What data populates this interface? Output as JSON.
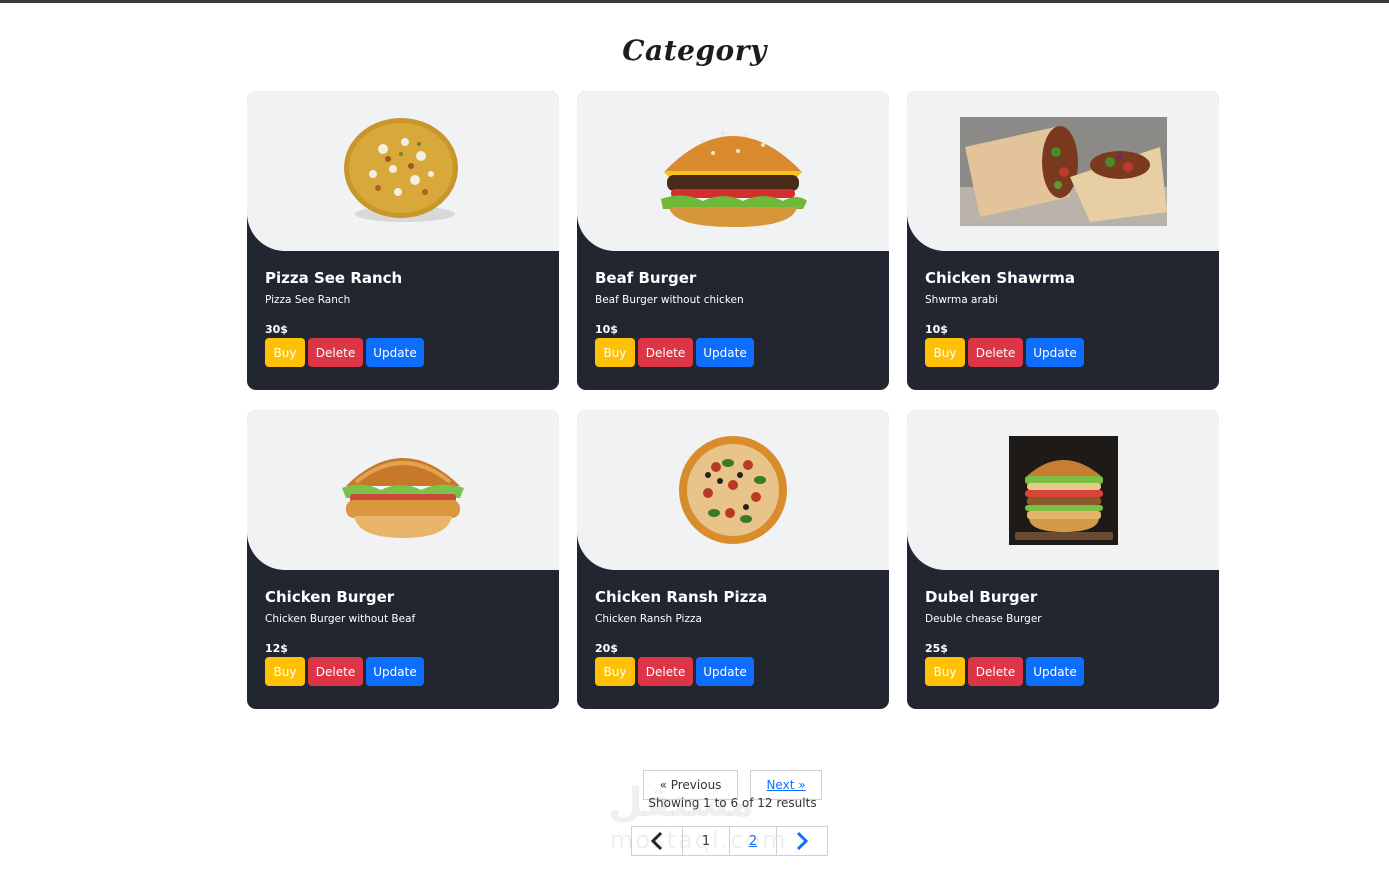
{
  "page": {
    "title": "Category"
  },
  "cards": [
    {
      "name": "Pizza See Ranch",
      "desc": "Pizza See Ranch",
      "price": "30$",
      "image": "pizza-onion-image"
    },
    {
      "name": "Beaf Burger",
      "desc": "Beaf Burger without chicken",
      "price": "10$",
      "image": "beef-burger-image"
    },
    {
      "name": "Chicken Shawrma",
      "desc": "Shwrma arabi",
      "price": "10$",
      "image": "shawarma-image"
    },
    {
      "name": "Chicken Burger",
      "desc": "Chicken Burger without Beaf",
      "price": "12$",
      "image": "chicken-burger-image"
    },
    {
      "name": "Chicken Ransh Pizza",
      "desc": "Chicken Ransh Pizza",
      "price": "20$",
      "image": "pizza-image"
    },
    {
      "name": "Dubel Burger",
      "desc": "Deuble chease Burger",
      "price": "25$",
      "image": "double-burger-image"
    }
  ],
  "buttons": {
    "buy": "Buy",
    "delete": "Delete",
    "update": "Update"
  },
  "pagination": {
    "previous": "« Previous",
    "next": "Next »",
    "info": "Showing 1 to 6 of 12 results",
    "pages": [
      "1",
      "2"
    ]
  },
  "watermark": {
    "arabic": "مستقل",
    "latin": "mostaql.com"
  },
  "colors": {
    "card_dark": "#212631",
    "card_light": "#f1f2f4",
    "buy": "#ffc107",
    "delete": "#dc3545",
    "update": "#0d6efd"
  }
}
